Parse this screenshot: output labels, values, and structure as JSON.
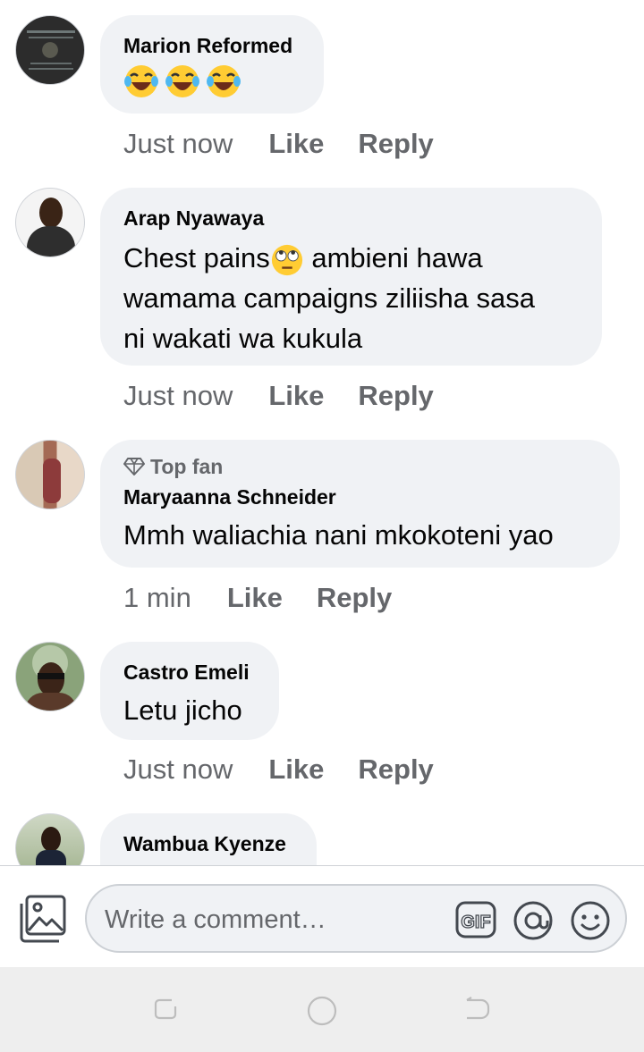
{
  "comments": [
    {
      "author": "Marion Reformed",
      "text": "",
      "emojis": [
        "laughing-tears-emoji",
        "laughing-tears-emoji",
        "laughing-tears-emoji"
      ],
      "time": "Just now",
      "like": "Like",
      "reply": "Reply"
    },
    {
      "author": "Arap Nyawaya",
      "text_part1": "Chest pains",
      "text_part2": " ambieni hawa",
      "text_line2": "wamama campaigns ziliisha sasa",
      "text_line3": "ni wakati wa kukula",
      "emoji": "eye-roll-emoji",
      "time": "Just now",
      "like": "Like",
      "reply": "Reply"
    },
    {
      "badge": "Top fan",
      "badge_icon": "diamond-icon",
      "author": "Maryaanna Schneider",
      "text": "Mmh waliachia nani mkokoteni yao",
      "time": "1 min",
      "like": "Like",
      "reply": "Reply"
    },
    {
      "author": "Castro Emeli",
      "text": "Letu jicho",
      "time": "Just now",
      "like": "Like",
      "reply": "Reply"
    },
    {
      "author": "Wambua Kyenze"
    }
  ],
  "composer": {
    "placeholder": "Write a comment…",
    "gif_label": "GIF",
    "icons": [
      "photo-icon",
      "gif-icon",
      "mention-icon",
      "emoji-icon"
    ]
  },
  "navbar": {
    "icons": [
      "recent-apps-icon",
      "home-icon",
      "back-icon"
    ]
  },
  "colors": {
    "bubble": "#f0f2f5",
    "secondary_text": "#65676b",
    "nav_background": "#eeeeee"
  }
}
